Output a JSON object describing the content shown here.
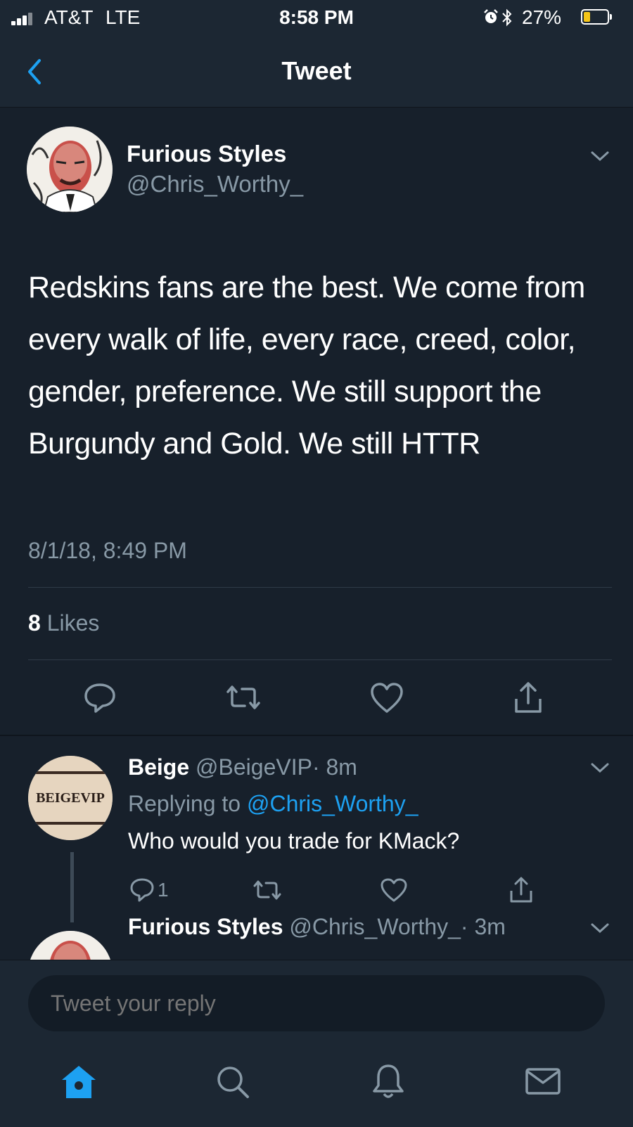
{
  "status_bar": {
    "carrier": "AT&T",
    "network": "LTE",
    "time": "8:58 PM",
    "battery": "27%",
    "battery_level": 0.27,
    "icons": [
      "signal-icon",
      "alarm-icon",
      "bluetooth-icon",
      "battery-icon"
    ]
  },
  "nav": {
    "title": "Tweet",
    "back_icon": "chevron-left-icon"
  },
  "tweet": {
    "author_name": "Furious Styles",
    "author_handle": "@Chris_Worthy_",
    "text": "Redskins fans are the best. We come from every walk of life, every race, creed, color, gender, preference. We still support the Burgundy and Gold. We still HTTR",
    "timestamp": "8/1/18, 8:49 PM",
    "likes_count": "8",
    "likes_label": "Likes",
    "actions": [
      "reply-icon",
      "retweet-icon",
      "like-icon",
      "share-icon"
    ]
  },
  "replies": [
    {
      "author_name": "Beige",
      "author_handle": "@BeigeVIP",
      "time": "· 8m",
      "avatar_text": "BEIGEVIP",
      "replying_label": "Replying to",
      "replying_handle": "@Chris_Worthy_",
      "text": "Who would you trade for KMack?",
      "reply_count": "1"
    },
    {
      "author_name": "Furious Styles",
      "author_handle": "@Chris_Worthy_",
      "time": "· 3m"
    }
  ],
  "composer": {
    "placeholder": "Tweet your reply"
  },
  "tabbar": [
    "home-icon",
    "search-icon",
    "notifications-icon",
    "messages-icon"
  ],
  "colors": {
    "background": "#17202b",
    "bar": "#1c2733",
    "accent": "#1da1f2",
    "secondary": "#8899a6",
    "battery": "#f5c518"
  }
}
